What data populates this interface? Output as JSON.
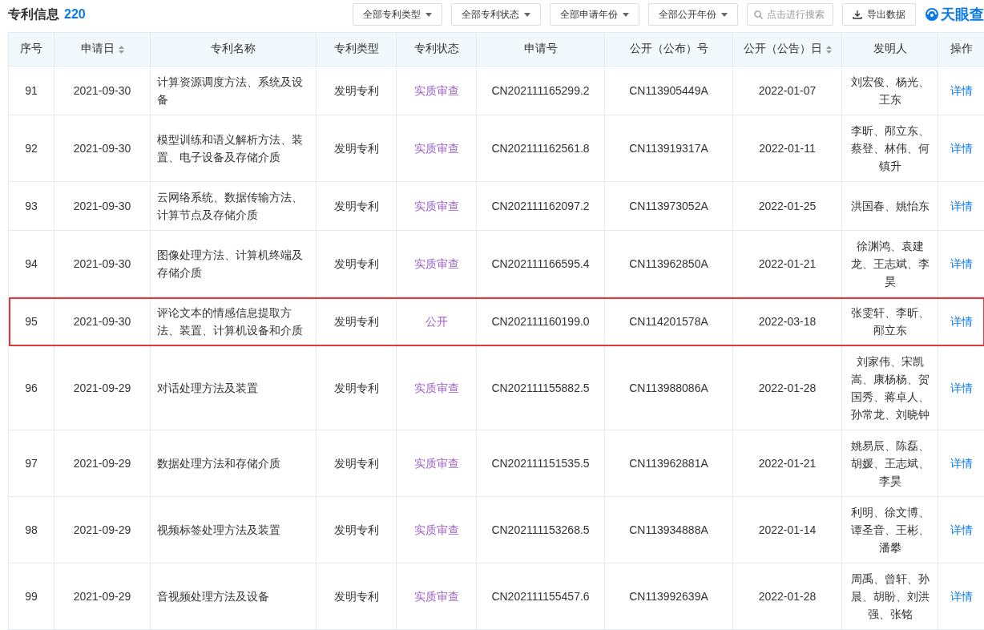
{
  "header": {
    "title": "专利信息",
    "count": "220",
    "filters": [
      {
        "label": "全部专利类型"
      },
      {
        "label": "全部专利状态"
      },
      {
        "label": "全部申请年份"
      },
      {
        "label": "全部公开年份"
      }
    ],
    "search": {
      "placeholder": "点击进行搜索"
    },
    "export_button": "导出数据",
    "logo": "天眼查"
  },
  "table": {
    "columns": [
      {
        "label": "序号",
        "sortable": false
      },
      {
        "label": "申请日",
        "sortable": true
      },
      {
        "label": "专利名称",
        "sortable": false
      },
      {
        "label": "专利类型",
        "sortable": false
      },
      {
        "label": "专利状态",
        "sortable": false
      },
      {
        "label": "申请号",
        "sortable": false
      },
      {
        "label": "公开（公布）号",
        "sortable": false
      },
      {
        "label": "公开（公告）日",
        "sortable": true
      },
      {
        "label": "发明人",
        "sortable": false
      },
      {
        "label": "操作",
        "sortable": false
      }
    ],
    "rows": [
      {
        "index": "91",
        "date": "2021-09-30",
        "name": "计算资源调度方法、系统及设备",
        "type": "发明专利",
        "status": "实质审查",
        "app_no": "CN202111165299.2",
        "pub_no": "CN113905449A",
        "pub_date": "2022-01-07",
        "inventors": "刘宏俊、杨光、王东",
        "action": "详情",
        "highlighted": false
      },
      {
        "index": "92",
        "date": "2021-09-30",
        "name": "模型训练和语义解析方法、装置、电子设备及存储介质",
        "type": "发明专利",
        "status": "实质审查",
        "app_no": "CN202111162561.8",
        "pub_no": "CN113919317A",
        "pub_date": "2022-01-11",
        "inventors": "李昕、邴立东、蔡登、林伟、何镇升",
        "action": "详情",
        "highlighted": false
      },
      {
        "index": "93",
        "date": "2021-09-30",
        "name": "云网络系统、数据传输方法、计算节点及存储介质",
        "type": "发明专利",
        "status": "实质审查",
        "app_no": "CN202111162097.2",
        "pub_no": "CN113973052A",
        "pub_date": "2022-01-25",
        "inventors": "洪国春、姚怡东",
        "action": "详情",
        "highlighted": false
      },
      {
        "index": "94",
        "date": "2021-09-30",
        "name": "图像处理方法、计算机终端及存储介质",
        "type": "发明专利",
        "status": "实质审查",
        "app_no": "CN202111166595.4",
        "pub_no": "CN113962850A",
        "pub_date": "2022-01-21",
        "inventors": "徐渊鸿、袁建龙、王志斌、李昊",
        "action": "详情",
        "highlighted": false
      },
      {
        "index": "95",
        "date": "2021-09-30",
        "name": "评论文本的情感信息提取方法、装置、计算机设备和介质",
        "type": "发明专利",
        "status": "公开",
        "app_no": "CN202111160199.0",
        "pub_no": "CN114201578A",
        "pub_date": "2022-03-18",
        "inventors": "张雯轩、李昕、邴立东",
        "action": "详情",
        "highlighted": true
      },
      {
        "index": "96",
        "date": "2021-09-29",
        "name": "对话处理方法及装置",
        "type": "发明专利",
        "status": "实质审查",
        "app_no": "CN202111155882.5",
        "pub_no": "CN113988086A",
        "pub_date": "2022-01-28",
        "inventors": "刘家伟、宋凯嵩、康杨杨、贺国秀、蒋卓人、孙常龙、刘晓钟",
        "action": "详情",
        "highlighted": false
      },
      {
        "index": "97",
        "date": "2021-09-29",
        "name": "数据处理方法和存储介质",
        "type": "发明专利",
        "status": "实质审查",
        "app_no": "CN202111151535.5",
        "pub_no": "CN113962881A",
        "pub_date": "2022-01-21",
        "inventors": "姚易辰、陈磊、胡媛、王志斌、李昊",
        "action": "详情",
        "highlighted": false
      },
      {
        "index": "98",
        "date": "2021-09-29",
        "name": "视频标签处理方法及装置",
        "type": "发明专利",
        "status": "实质审查",
        "app_no": "CN202111153268.5",
        "pub_no": "CN113934888A",
        "pub_date": "2022-01-14",
        "inventors": "利明、徐文博、谭圣音、王彬、潘攀",
        "action": "详情",
        "highlighted": false
      },
      {
        "index": "99",
        "date": "2021-09-29",
        "name": "音视频处理方法及设备",
        "type": "发明专利",
        "status": "实质审查",
        "app_no": "CN202111155457.6",
        "pub_no": "CN113992639A",
        "pub_date": "2022-01-28",
        "inventors": "周禹、曾轩、孙晨、胡盼、刘洪强、张铭",
        "action": "详情",
        "highlighted": false
      }
    ]
  }
}
